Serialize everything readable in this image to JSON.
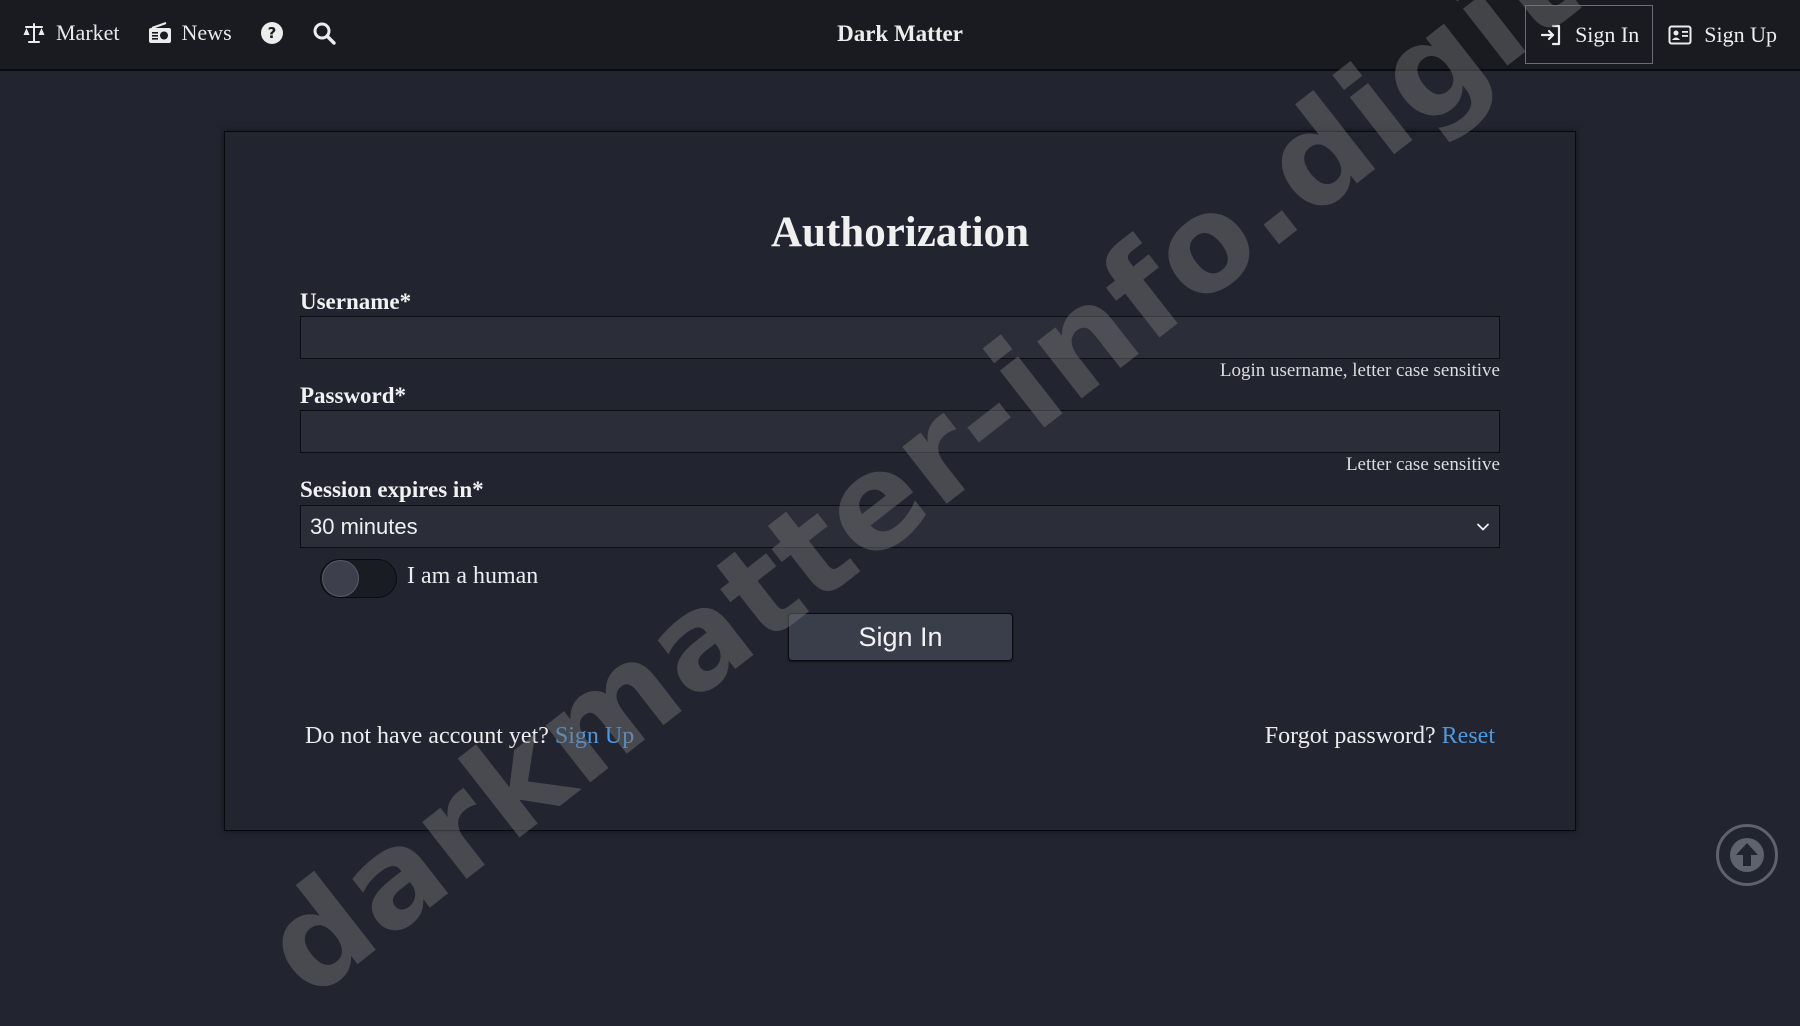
{
  "navbar": {
    "items": [
      {
        "label": "Market",
        "icon": "scale-icon"
      },
      {
        "label": "News",
        "icon": "radio-icon"
      }
    ],
    "help_icon": "question-circle-icon",
    "search_icon": "search-icon",
    "brand": "Dark Matter",
    "sign_in_label": "Sign In",
    "sign_up_label": "Sign Up"
  },
  "form": {
    "title": "Authorization",
    "username_label": "Username*",
    "username_value": "",
    "username_hint": "Login username, letter case sensitive",
    "password_label": "Password*",
    "password_value": "",
    "password_hint": "Letter case sensitive",
    "session_label": "Session expires in*",
    "session_value": "30 minutes",
    "human_label": "I am a human",
    "human_checked": false,
    "submit_label": "Sign In",
    "no_account_text": "Do not have account yet?",
    "signup_link": "Sign Up",
    "forgot_text": "Forgot password?",
    "reset_link": "Reset"
  },
  "watermark": "darkmatter-info.digital",
  "colors": {
    "background": "#222530",
    "navbar": "#191b21",
    "link": "#4a9ae3",
    "input": "#2b2e39",
    "button": "#3a3d4a"
  }
}
